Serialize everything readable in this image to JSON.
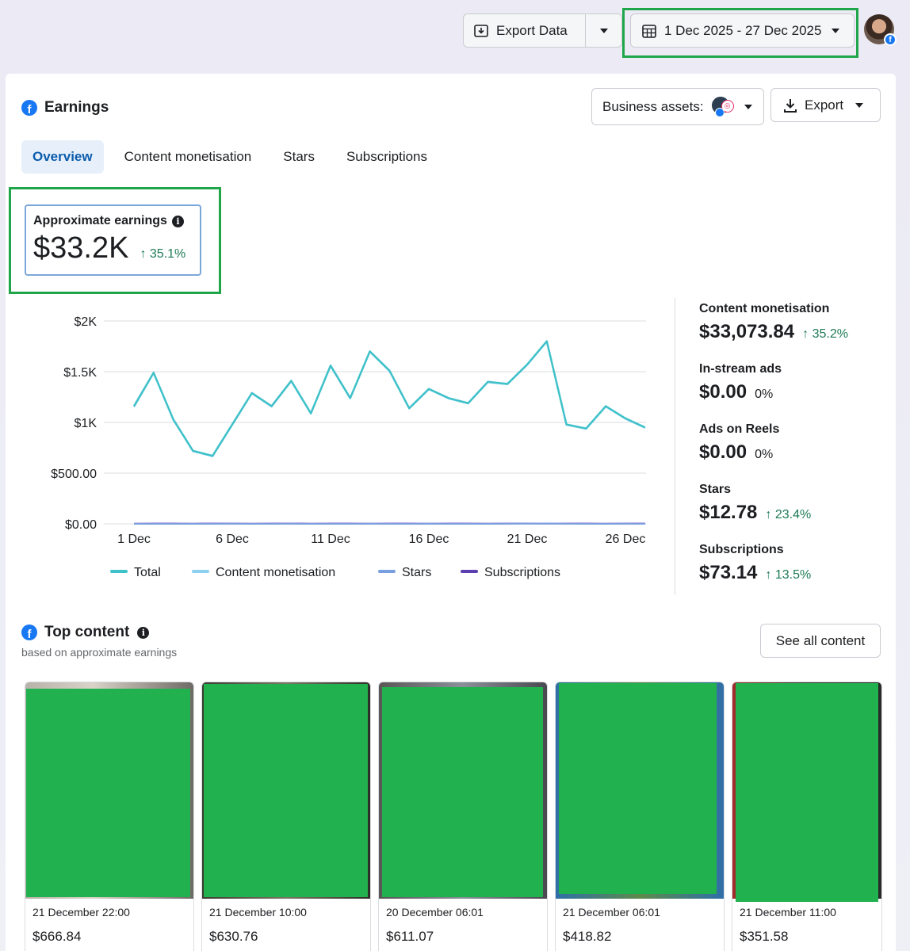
{
  "header": {
    "export_data_label": "Export Data",
    "date_range_label": "1 Dec 2025 - 27 Dec 2025"
  },
  "card": {
    "title": "Earnings",
    "business_assets_label": "Business assets:",
    "export_label": "Export",
    "tabs": [
      {
        "label": "Overview",
        "active": true
      },
      {
        "label": "Content monetisation",
        "active": false
      },
      {
        "label": "Stars",
        "active": false
      },
      {
        "label": "Subscriptions",
        "active": false
      }
    ]
  },
  "earnings": {
    "label": "Approximate earnings",
    "value": "$33.2K",
    "change": "35.1%"
  },
  "chart_data": {
    "type": "line",
    "title": "",
    "xlabel": "",
    "ylabel": "",
    "x": [
      "1 Dec",
      "2 Dec",
      "3 Dec",
      "4 Dec",
      "5 Dec",
      "6 Dec",
      "7 Dec",
      "8 Dec",
      "9 Dec",
      "10 Dec",
      "11 Dec",
      "12 Dec",
      "13 Dec",
      "14 Dec",
      "15 Dec",
      "16 Dec",
      "17 Dec",
      "18 Dec",
      "19 Dec",
      "20 Dec",
      "21 Dec",
      "22 Dec",
      "23 Dec",
      "24 Dec",
      "25 Dec",
      "26 Dec",
      "27 Dec"
    ],
    "x_ticks": [
      "1 Dec",
      "6 Dec",
      "11 Dec",
      "16 Dec",
      "21 Dec",
      "26 Dec"
    ],
    "y_ticks": [
      "$2K",
      "$1.5K",
      "$1K",
      "$500.00",
      "$0.00"
    ],
    "ylim": [
      0,
      2000
    ],
    "grid": true,
    "legend_position": "bottom",
    "series": [
      {
        "name": "Total",
        "color": "#3fc1c9",
        "values": [
          1160,
          1490,
          1030,
          720,
          670,
          980,
          1290,
          1160,
          1410,
          1090,
          1560,
          1240,
          1700,
          1510,
          1140,
          1330,
          1240,
          1190,
          1400,
          1380,
          1570,
          1800,
          980,
          940,
          1160,
          1040,
          950
        ]
      },
      {
        "name": "Content monetisation",
        "color": "#8ed0f0",
        "values": [
          1150,
          1485,
          1025,
          715,
          665,
          975,
          1285,
          1155,
          1405,
          1085,
          1555,
          1235,
          1695,
          1505,
          1135,
          1325,
          1235,
          1185,
          1395,
          1375,
          1565,
          1795,
          975,
          935,
          1155,
          1035,
          945
        ]
      },
      {
        "name": "Stars",
        "color": "#7a9fe0",
        "values": [
          0,
          0,
          0,
          0,
          0,
          1,
          0,
          0,
          1,
          0,
          0,
          0,
          1,
          0,
          0,
          1,
          0,
          0,
          0,
          1,
          2,
          3,
          1,
          0,
          0,
          1,
          0
        ]
      },
      {
        "name": "Subscriptions",
        "color": "#5b3fb0",
        "values": [
          2,
          3,
          3,
          2,
          3,
          3,
          2,
          3,
          3,
          2,
          3,
          3,
          2,
          3,
          3,
          2,
          3,
          3,
          2,
          3,
          3,
          2,
          3,
          3,
          2,
          3,
          3
        ]
      }
    ]
  },
  "summary": [
    {
      "label": "Content monetisation",
      "value": "$33,073.84",
      "change": "35.2%",
      "up": true
    },
    {
      "label": "In-stream ads",
      "value": "$0.00",
      "change": "0%",
      "up": false
    },
    {
      "label": "Ads on Reels",
      "value": "$0.00",
      "change": "0%",
      "up": false
    },
    {
      "label": "Stars",
      "value": "$12.78",
      "change": "23.4%",
      "up": true
    },
    {
      "label": "Subscriptions",
      "value": "$73.14",
      "change": "13.5%",
      "up": true
    }
  ],
  "top_content": {
    "title": "Top content",
    "subtitle": "based on approximate earnings",
    "see_all_label": "See all content",
    "items": [
      {
        "date": "21 December 22:00",
        "amount": "$666.84"
      },
      {
        "date": "21 December 10:00",
        "amount": "$630.76"
      },
      {
        "date": "20 December 06:01",
        "amount": "$611.07"
      },
      {
        "date": "21 December 06:01",
        "amount": "$418.82"
      },
      {
        "date": "21 December 11:00",
        "amount": "$351.58"
      }
    ]
  },
  "colors": {
    "accent": "#1877f2",
    "highlight": "#1fa64a",
    "redaction": "#21b14e",
    "positive": "#1d7a55"
  }
}
